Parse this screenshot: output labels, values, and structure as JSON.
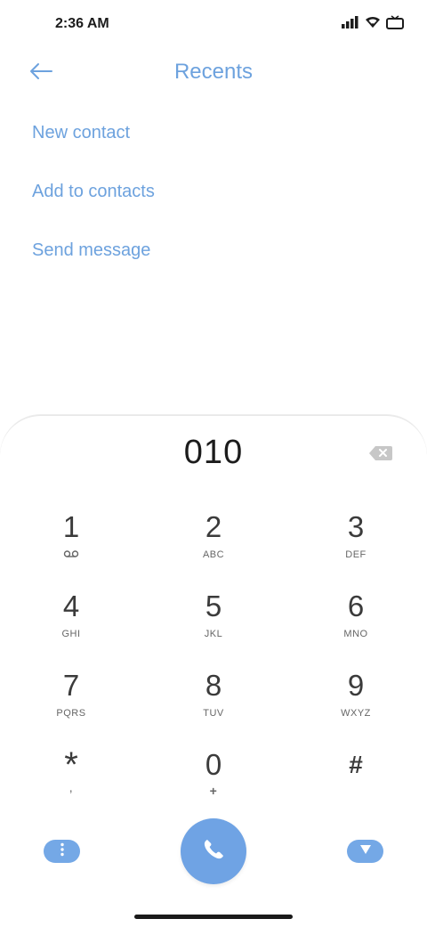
{
  "status_bar": {
    "time": "2:36 AM",
    "icons": [
      "signal-icon",
      "wifi-icon",
      "tv-icon"
    ]
  },
  "header": {
    "title": "Recents",
    "back_icon": "back-arrow-icon"
  },
  "menu": {
    "items": [
      {
        "label": "New contact"
      },
      {
        "label": "Add to contacts"
      },
      {
        "label": "Send message"
      }
    ]
  },
  "dialer": {
    "number": "010",
    "backspace_icon": "backspace-icon",
    "keys": [
      {
        "digit": "1",
        "letters": ""
      },
      {
        "digit": "2",
        "letters": "ABC"
      },
      {
        "digit": "3",
        "letters": "DEF"
      },
      {
        "digit": "4",
        "letters": "GHI"
      },
      {
        "digit": "5",
        "letters": "JKL"
      },
      {
        "digit": "6",
        "letters": "MNO"
      },
      {
        "digit": "7",
        "letters": "PQRS"
      },
      {
        "digit": "8",
        "letters": "TUV"
      },
      {
        "digit": "9",
        "letters": "WXYZ"
      },
      {
        "digit": "*",
        "letters": ","
      },
      {
        "digit": "0",
        "letters": "+"
      },
      {
        "digit": "#",
        "letters": ""
      }
    ],
    "more_icon": "more-vertical-icon",
    "call_icon": "phone-icon",
    "hide_icon": "triangle-down-icon"
  },
  "colors": {
    "accent": "#6da2de",
    "button": "#74a8e6"
  }
}
